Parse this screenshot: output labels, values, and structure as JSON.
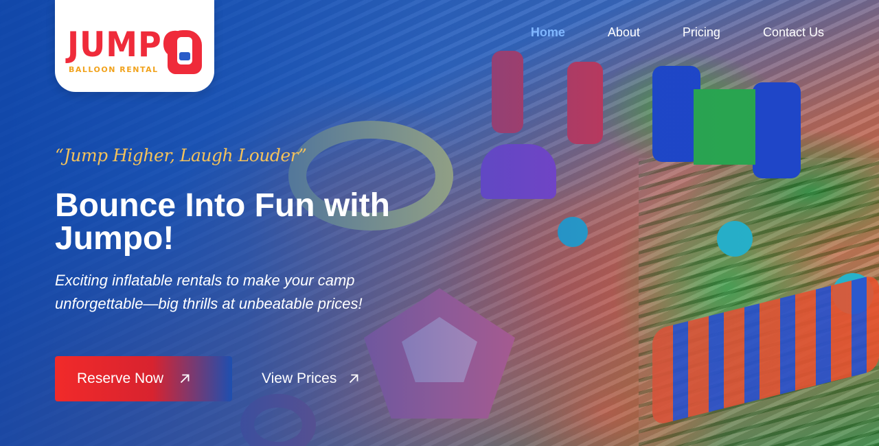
{
  "brand": {
    "name": "JUMPO",
    "subtitle": "BALLOON RENTAL"
  },
  "nav": {
    "items": [
      {
        "label": "Home",
        "active": true
      },
      {
        "label": "About",
        "active": false
      },
      {
        "label": "Pricing",
        "active": false
      },
      {
        "label": "Contact Us",
        "active": false
      }
    ]
  },
  "hero": {
    "tagline": "“Jump Higher, Laugh Louder”",
    "headline_line1": "Bounce Into Fun with",
    "headline_line2": "Jumpo!",
    "subtext_line1": "Exciting inflatable rentals to make your camp",
    "subtext_line2": "unforgettable—big thrills at unbeatable prices!",
    "primary_cta": "Reserve Now",
    "secondary_cta": "View Prices",
    "cta_icon": "arrow-up-right-icon"
  },
  "colors": {
    "brand_red": "#ef2b3a",
    "brand_yellow": "#f1a21b",
    "tagline_gold": "#f3c25c",
    "nav_active": "#7fb6ff",
    "hero_blue": "#1d4fa8"
  }
}
